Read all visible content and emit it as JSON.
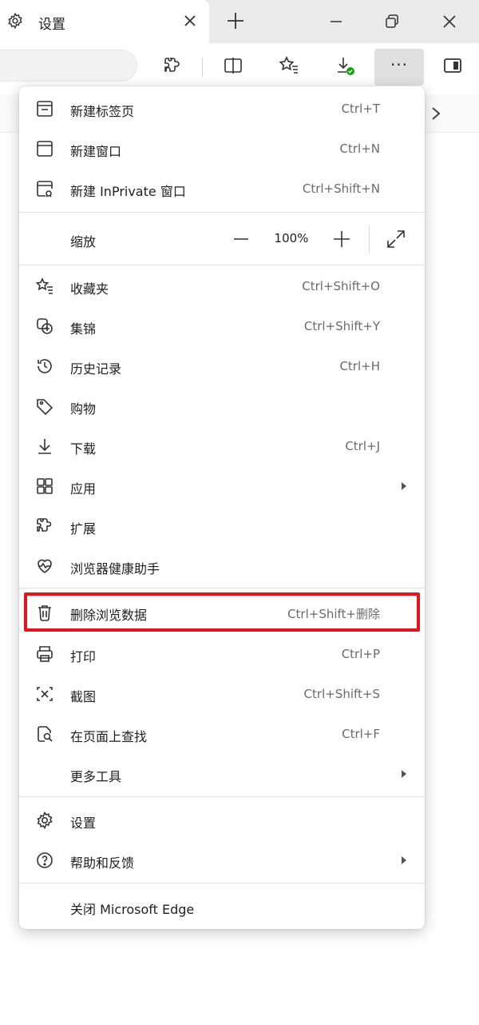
{
  "tab": {
    "title": "设置",
    "icon": "gear-icon"
  },
  "window": {
    "new_tab_icon": "plus-icon",
    "minimize_icon": "minimize-icon",
    "restore_icon": "restore-icon",
    "close_icon": "close-icon"
  },
  "toolbar": {
    "buttons": [
      "extensions-icon",
      "split-screen-icon",
      "favorites-icon",
      "downloads-icon",
      "more-icon",
      "sidebar-icon"
    ],
    "more_label": "···"
  },
  "menu": {
    "group1": [
      {
        "label": "新建标签页",
        "shortcut": "Ctrl+T",
        "icon": "new-tab-icon"
      },
      {
        "label": "新建窗口",
        "shortcut": "Ctrl+N",
        "icon": "new-window-icon"
      },
      {
        "label": "新建 InPrivate 窗口",
        "shortcut": "Ctrl+Shift+N",
        "icon": "inprivate-window-icon"
      }
    ],
    "zoom": {
      "label": "缩放",
      "value": "100%",
      "minus": "—",
      "plus": "+"
    },
    "group2": [
      {
        "label": "收藏夹",
        "shortcut": "Ctrl+Shift+O",
        "icon": "favorites-icon"
      },
      {
        "label": "集锦",
        "shortcut": "Ctrl+Shift+Y",
        "icon": "collections-icon"
      },
      {
        "label": "历史记录",
        "shortcut": "Ctrl+H",
        "icon": "history-icon"
      },
      {
        "label": "购物",
        "shortcut": "",
        "icon": "shopping-tag-icon"
      },
      {
        "label": "下载",
        "shortcut": "Ctrl+J",
        "icon": "download-icon"
      },
      {
        "label": "应用",
        "shortcut": "",
        "icon": "apps-icon",
        "submenu": true
      },
      {
        "label": "扩展",
        "shortcut": "",
        "icon": "extensions-icon"
      },
      {
        "label": "浏览器健康助手",
        "shortcut": "",
        "icon": "heart-pulse-icon"
      },
      {
        "label": "删除浏览数据",
        "shortcut": "Ctrl+Shift+删除",
        "icon": "trash-icon",
        "highlighted": true
      },
      {
        "label": "打印",
        "shortcut": "Ctrl+P",
        "icon": "printer-icon"
      },
      {
        "label": "截图",
        "shortcut": "Ctrl+Shift+S",
        "icon": "screenshot-icon"
      },
      {
        "label": "在页面上查找",
        "shortcut": "Ctrl+F",
        "icon": "find-on-page-icon"
      },
      {
        "label": "更多工具",
        "shortcut": "",
        "icon": "",
        "submenu": true
      }
    ],
    "group3": [
      {
        "label": "设置",
        "shortcut": "",
        "icon": "gear-icon"
      },
      {
        "label": "帮助和反馈",
        "shortcut": "",
        "icon": "help-icon",
        "submenu": true
      }
    ],
    "close": {
      "label": "关闭 Microsoft Edge"
    }
  },
  "colors": {
    "highlight": "#e3141b",
    "download_badge": "#13a10e"
  }
}
